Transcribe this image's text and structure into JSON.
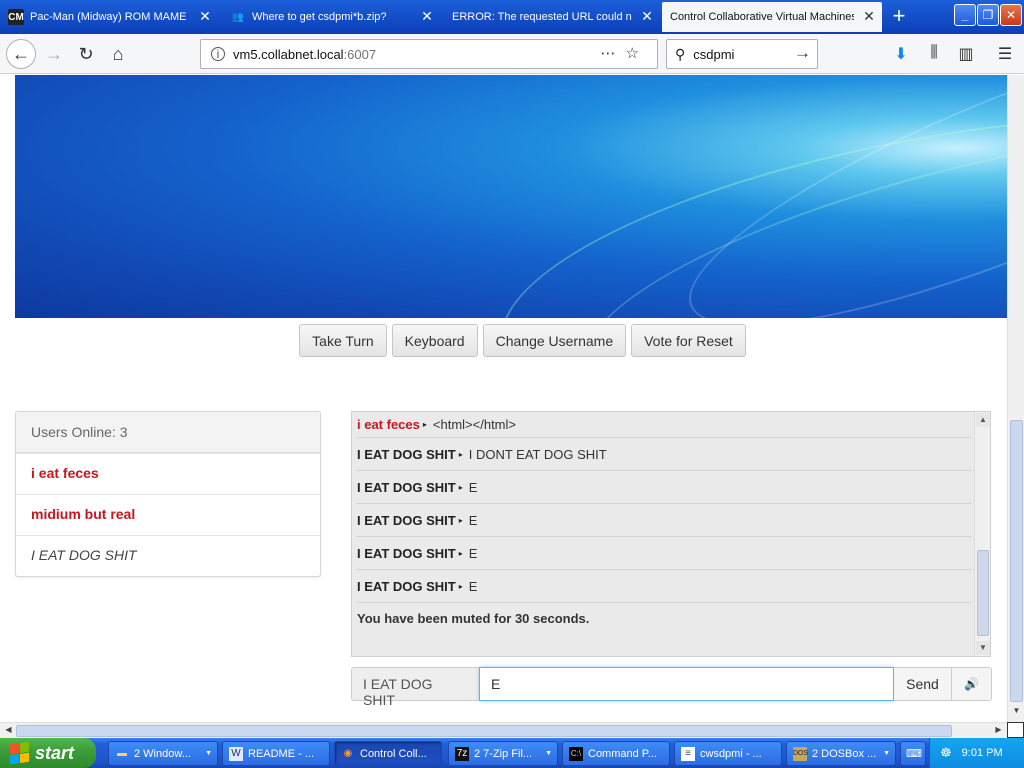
{
  "browser": {
    "tabs": [
      {
        "label": "Pac-Man (Midway) ROM MAME - C",
        "favicon": "CM",
        "active": false
      },
      {
        "label": "Where to get csdpmi*b.zip?",
        "favicon": "people-icon",
        "active": false
      },
      {
        "label": "ERROR: The requested URL could not",
        "favicon": "",
        "active": false
      },
      {
        "label": "Control Collaborative Virtual Machines",
        "favicon": "",
        "active": true
      }
    ],
    "address": {
      "host": "vm5.collabnet.local",
      "port": ":6007"
    },
    "search_value": "csdpmi"
  },
  "vm_controls": {
    "take_turn": "Take Turn",
    "keyboard": "Keyboard",
    "change_username": "Change Username",
    "vote_reset": "Vote for Reset"
  },
  "users_panel": {
    "heading": "Users Online: 3",
    "users": [
      {
        "name": "i eat feces",
        "style": "red"
      },
      {
        "name": "midium but real",
        "style": "red"
      },
      {
        "name": "I EAT DOG SHIT",
        "style": "self"
      }
    ]
  },
  "chat": {
    "messages": [
      {
        "user": "i eat feces",
        "text": "<html></html>",
        "style": "red"
      },
      {
        "user": "I EAT DOG SHIT",
        "text": "I DONT EAT DOG SHIT",
        "style": "normal"
      },
      {
        "user": "I EAT DOG SHIT",
        "text": "E",
        "style": "normal"
      },
      {
        "user": "I EAT DOG SHIT",
        "text": "E",
        "style": "normal"
      },
      {
        "user": "I EAT DOG SHIT",
        "text": "E",
        "style": "normal"
      },
      {
        "user": "I EAT DOG SHIT",
        "text": "E",
        "style": "normal"
      }
    ],
    "system_message": "You have been muted for 30 seconds.",
    "username_label": "I EAT DOG SHIT",
    "input_value": "E",
    "send_label": "Send"
  },
  "taskbar": {
    "start_label": "start",
    "items": [
      {
        "label": "2 Window...",
        "icon": "folder-icon",
        "arrow": true,
        "active": false
      },
      {
        "label": "README - ...",
        "icon": "wordpad-icon",
        "arrow": false,
        "active": false
      },
      {
        "label": "Control Coll...",
        "icon": "firefox-icon",
        "arrow": false,
        "active": true
      },
      {
        "label": "2 7-Zip Fil...",
        "icon": "7zip-icon",
        "arrow": true,
        "active": false
      },
      {
        "label": "Command P...",
        "icon": "cmd-icon",
        "arrow": false,
        "active": false
      },
      {
        "label": "cwsdpmi - ...",
        "icon": "notepad-icon",
        "arrow": false,
        "active": false
      },
      {
        "label": "2 DOSBox ...",
        "icon": "dosbox-icon",
        "arrow": true,
        "active": false
      }
    ],
    "clock": "9:01 PM"
  }
}
